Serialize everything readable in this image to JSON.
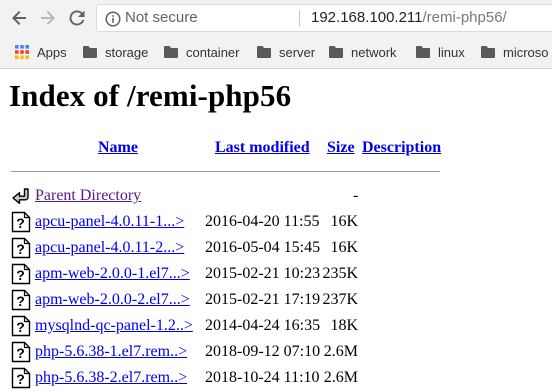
{
  "browser": {
    "security_label": "Not secure",
    "url_host": "192.168.100.211",
    "url_path": "/remi-php56/"
  },
  "bookmarks": [
    {
      "label": "Apps",
      "icon": "apps-grid-icon"
    },
    {
      "label": "storage",
      "icon": "folder-icon"
    },
    {
      "label": "container",
      "icon": "folder-icon"
    },
    {
      "label": "server",
      "icon": "folder-icon"
    },
    {
      "label": "network",
      "icon": "folder-icon"
    },
    {
      "label": "linux",
      "icon": "folder-icon"
    },
    {
      "label": "microso",
      "icon": "folder-icon"
    }
  ],
  "page": {
    "title": "Index of /remi-php56",
    "columns": {
      "name": "Name",
      "last_modified": "Last modified",
      "size": "Size",
      "description": "Description"
    },
    "parent": {
      "label": "Parent Directory",
      "size": "-",
      "icon": "back-arrow-icon"
    },
    "rows": [
      {
        "name": "apcu-panel-4.0.11-1...>",
        "modified": "2016-04-20 11:55",
        "size": "16K",
        "icon": "unknown-file-icon"
      },
      {
        "name": "apcu-panel-4.0.11-2...>",
        "modified": "2016-05-04 15:45",
        "size": "16K",
        "icon": "unknown-file-icon"
      },
      {
        "name": "apm-web-2.0.0-1.el7...>",
        "modified": "2015-02-21 10:23",
        "size": "235K",
        "icon": "unknown-file-icon"
      },
      {
        "name": "apm-web-2.0.0-2.el7...>",
        "modified": "2015-02-21 17:19",
        "size": "237K",
        "icon": "unknown-file-icon"
      },
      {
        "name": "mysqlnd-qc-panel-1.2..>",
        "modified": "2014-04-24 16:35",
        "size": "18K",
        "icon": "unknown-file-icon"
      },
      {
        "name": "php-5.6.38-1.el7.rem..>",
        "modified": "2018-09-12 07:10",
        "size": "2.6M",
        "icon": "unknown-file-icon"
      },
      {
        "name": "php-5.6.38-2.el7.rem..>",
        "modified": "2018-10-24 11:10",
        "size": "2.6M",
        "icon": "unknown-file-icon"
      }
    ]
  }
}
